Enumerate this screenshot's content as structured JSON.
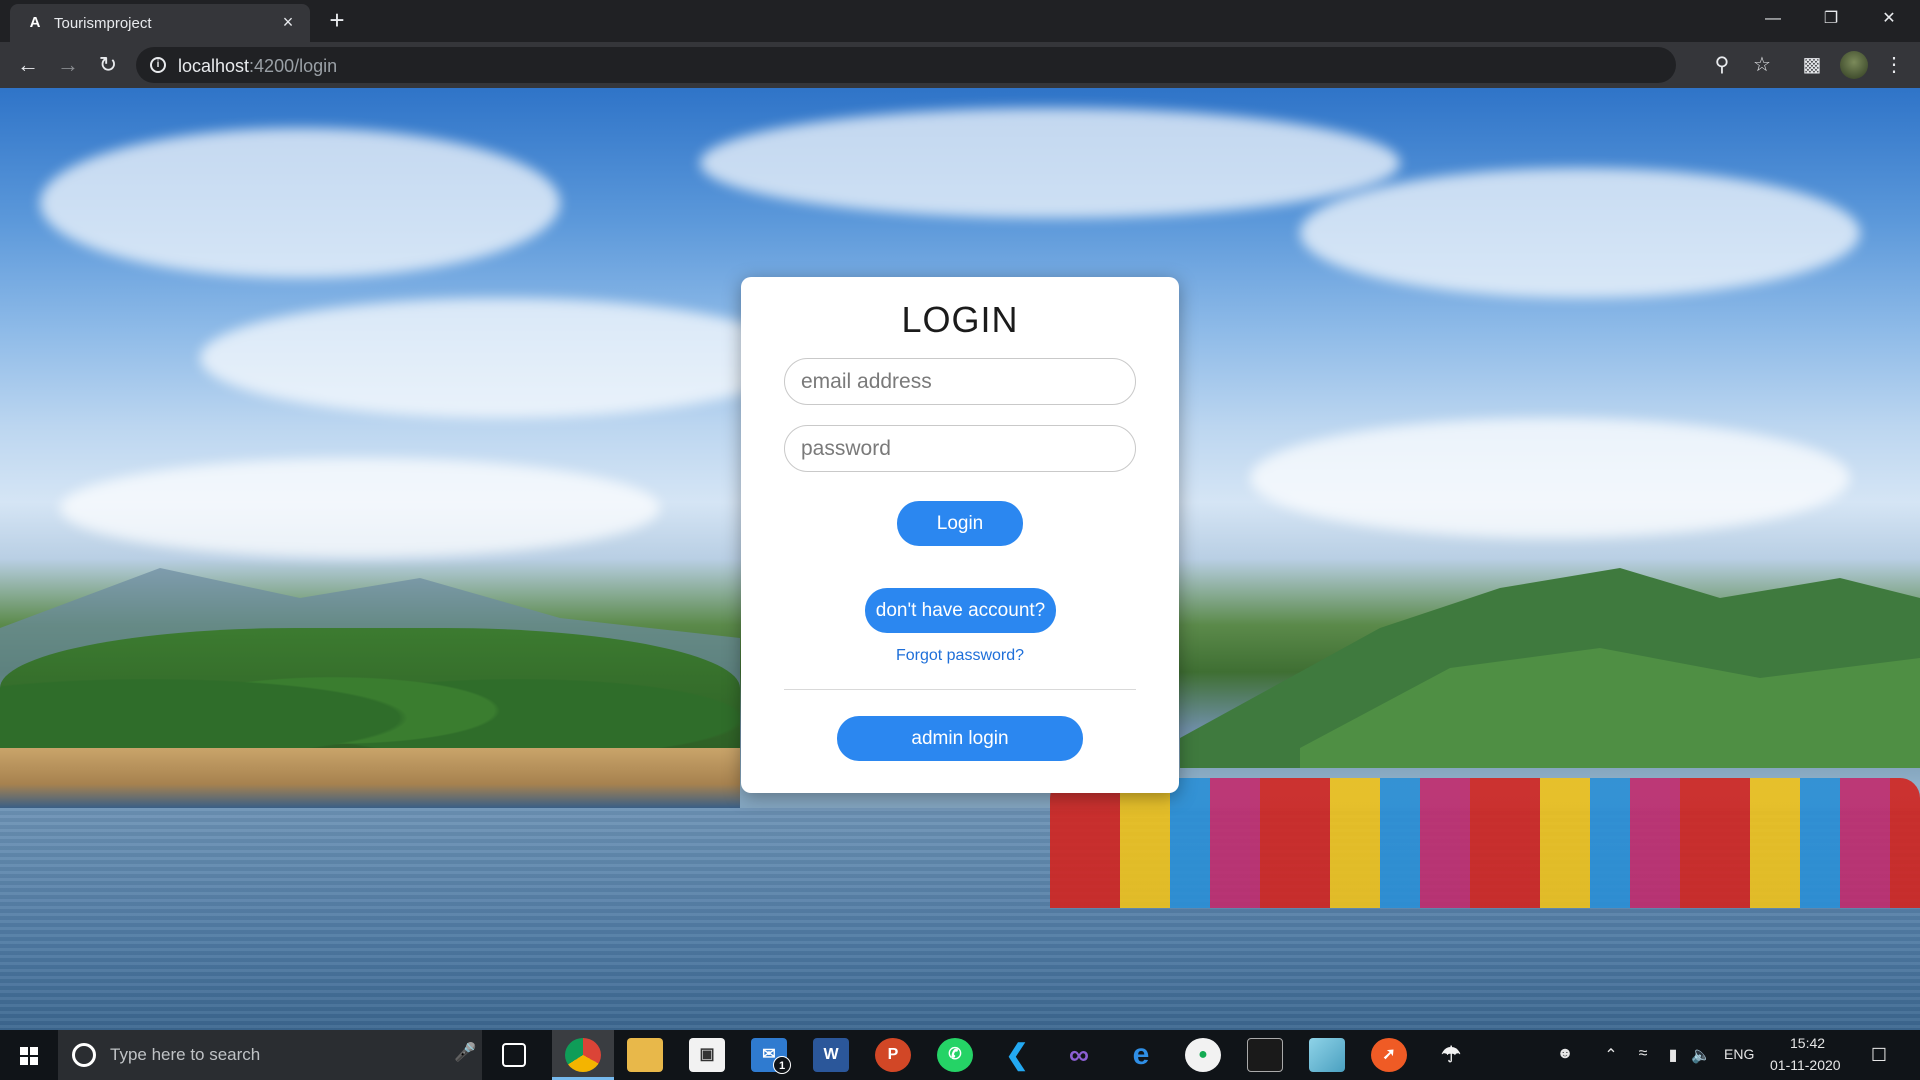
{
  "browser": {
    "tab_title": "Tourismproject",
    "tab_favicon": "A",
    "close_tab_glyph": "×",
    "new_tab_glyph": "+",
    "url_host": "localhost",
    "url_path": ":4200/login",
    "icons": [
      "back-icon",
      "forward-icon",
      "reload-icon",
      "info-icon",
      "key-icon",
      "star-icon",
      "extensions-icon",
      "avatar",
      "menu-icon",
      "minimize-icon",
      "restore-icon",
      "close-icon"
    ]
  },
  "login": {
    "title": "LOGIN",
    "email_placeholder": "email address",
    "password_placeholder": "password",
    "login_button": "Login",
    "signup_button": "don't have account?",
    "forgot_link": "Forgot password?",
    "admin_button": "admin login",
    "accent_color": "#2b87f0"
  },
  "taskbar": {
    "search_placeholder": "Type here to search",
    "mail_badge": "1",
    "language": "ENG",
    "time": "15:42",
    "date": "01-11-2020",
    "apps": [
      "chrome-icon",
      "file-explorer-icon",
      "store-icon",
      "mail-icon",
      "word-icon",
      "powerpoint-icon",
      "whatsapp-icon",
      "vscode-icon",
      "visual-studio-icon",
      "edge-icon",
      "mongodb-compass-icon",
      "terminal-icon",
      "app-icon",
      "postman-icon",
      "app-icon-2"
    ]
  }
}
